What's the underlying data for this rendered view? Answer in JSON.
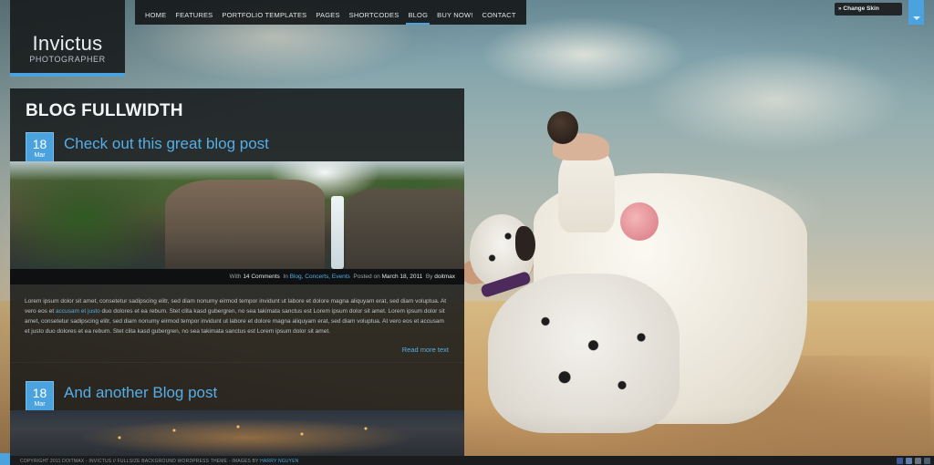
{
  "logo": {
    "title": "Invictus",
    "subtitle": "PHOTOGRAPHER"
  },
  "nav": {
    "items": [
      {
        "label": "HOME"
      },
      {
        "label": "FEATURES"
      },
      {
        "label": "PORTFOLIO TEMPLATES"
      },
      {
        "label": "PAGES"
      },
      {
        "label": "SHORTCODES"
      },
      {
        "label": "BLOG",
        "active": true
      },
      {
        "label": "BUY NOW!"
      },
      {
        "label": "CONTACT"
      }
    ]
  },
  "skin_switcher": {
    "label": "» Change Skin"
  },
  "page": {
    "title": "BLOG FULLWIDTH"
  },
  "posts": [
    {
      "day": "18",
      "month": "Mar",
      "title": "Check out this great blog post",
      "meta": {
        "with": "With",
        "comments": "14 Comments",
        "in": "In",
        "categories": [
          "Blog",
          "Concerts",
          "Events"
        ],
        "posted_on": "Posted on",
        "date": "March 18, 2011",
        "by": "By",
        "author": "doitmax"
      },
      "excerpt_part1": "Lorem ipsum dolor sit amet, consetetur sadipscing elitr, sed diam nonumy eirmod tempor invidunt ut labore et dolore magna aliquyam erat, sed diam voluptua. At vero eos et ",
      "excerpt_link": "accusam et justo",
      "excerpt_part2": " duo dolores et ea rebum. Stet clita kasd gubergren, no sea takimata sanctus est Lorem ipsum dolor sit amet. Lorem ipsum dolor sit amet, consetetur sadipscing elitr, sed diam nonumy eirmod tempor invidunt ut labore et dolore magna aliquyam erat, sed diam voluptua. At vero eos et accusam et justo duo dolores et ea rebum. Stet clita kasd gubergren, no sea takimata sanctus est Lorem ipsum dolor sit amet.",
      "read_more": "Read more text"
    },
    {
      "day": "18",
      "month": "Mar",
      "title": "And another Blog post"
    }
  ],
  "footer": {
    "text": "COPYRIGHT 2011 DOITMAX - INVICTUS // FULLSIZE BACKGROUND WORDPRESS THEME - IMAGES BY ",
    "credit": "HARRY NGUYEN"
  },
  "colors": {
    "accent": "#4aa3df",
    "link": "#55aee6",
    "panel": "#111314"
  },
  "icons": [
    "facebook-icon",
    "twitter-icon",
    "rss-icon",
    "mail-icon"
  ]
}
